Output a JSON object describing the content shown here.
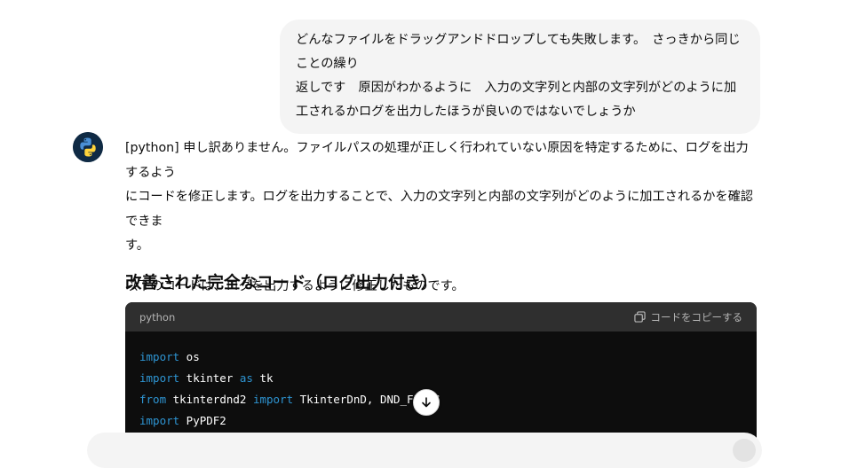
{
  "user_message": {
    "lines": [
      "どんなファイルをドラッグアンドドロップしても失敗します。　さっきから同じことの繰り",
      "返しです　原因がわかるように　入力の文字列と内部の文字列がどのように加",
      "工されるかログを出力したほうが良いのではないでしょうか"
    ]
  },
  "assistant": {
    "paragraph1_lines": [
      "[python] 申し訳ありません。ファイルパスの処理が正しく行われていない原因を特定するために、ログを出力するよう",
      "にコードを修正します。ログを出力することで、入力の文字列と内部の文字列がどのように加工されるかを確認できま",
      "す。"
    ],
    "paragraph2": "以下のコードは、ログを出力するように修正したものです。",
    "section_title": "改善された完全なコード（ログ出力付き）"
  },
  "code_block": {
    "language": "python",
    "copy_label": "コードをコピーする",
    "lines": [
      [
        {
          "t": "import",
          "k": true
        },
        {
          "t": " os",
          "k": false
        }
      ],
      [
        {
          "t": "import",
          "k": true
        },
        {
          "t": " tkinter ",
          "k": false
        },
        {
          "t": "as",
          "k": true
        },
        {
          "t": " tk",
          "k": false
        }
      ],
      [
        {
          "t": "from",
          "k": true
        },
        {
          "t": " tkinterdnd2 ",
          "k": false
        },
        {
          "t": "import",
          "k": true
        },
        {
          "t": " TkinterDnD, DND_FILES",
          "k": false
        }
      ],
      [
        {
          "t": "import",
          "k": true
        },
        {
          "t": " PyPDF2",
          "k": false
        }
      ]
    ]
  },
  "icons": {
    "avatar": "python-logo-icon",
    "copy": "copy-icon",
    "scroll": "arrow-down-icon"
  },
  "colors": {
    "keyword": "#2e95d3",
    "code_bg": "#0d0d0d",
    "code_header_bg": "#2f2f2f",
    "bubble_bg": "#f4f4f4"
  }
}
